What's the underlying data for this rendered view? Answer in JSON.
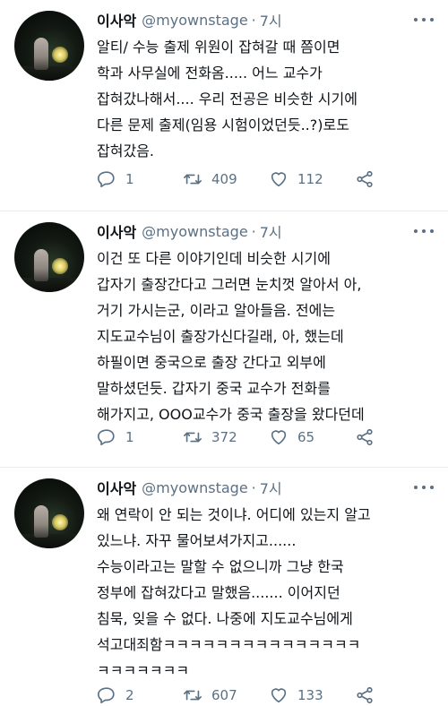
{
  "tweets": [
    {
      "name": "이사악",
      "handle": "@myownstage",
      "separator": "·",
      "time": "7시",
      "text": "알티/ 수능 출제 위원이 잡혀갈 때 쯤이면\n학과 사무실에 전화옴..... 어느 교수가\n잡혀갔나해서.... 우리 전공은 비슷한 시기에\n다른 문제 출제(임용 시험이었던듯..?)로도\n잡혀갔음.",
      "replies": "1",
      "retweets": "409",
      "likes": "112"
    },
    {
      "name": "이사악",
      "handle": "@myownstage",
      "separator": "·",
      "time": "7시",
      "text": "이건 또 다른 이야기인데 비슷한 시기에\n갑자기 출장간다고 그러면 눈치껏 알아서 아,\n거기 가시는군, 이라고 알아들음. 전에는\n지도교수님이 출장가신다길래, 아, 했는데\n하필이면 중국으로 출장 간다고 외부에\n말하셨던듯. 갑자기 중국 교수가 전화를\n해가지고, OOO교수가 중국 출장을 왔다던데",
      "replies": "1",
      "retweets": "372",
      "likes": "65"
    },
    {
      "name": "이사악",
      "handle": "@myownstage",
      "separator": "·",
      "time": "7시",
      "text": "왜 연락이 안 되는 것이냐. 어디에 있는지 알고\n있느냐. 자꾸 물어보셔가지고......\n수능이라고는 말할 수 없으니까 그냥 한국\n정부에 잡혀갔다고 말했음....... 이어지던\n침묵, 잊을 수 없다. 나중에 지도교수님에게\n석고대죄함ㅋㅋㅋㅋㅋㅋㅋㅋㅋㅋㅋㅋㅋㅋㅋ\nㅋㅋㅋㅋㅋㅋㅋ",
      "replies": "2",
      "retweets": "607",
      "likes": "133"
    }
  ],
  "icons": {
    "reply": "reply-icon",
    "retweet": "retweet-icon",
    "like": "heart-icon",
    "share": "share-icon",
    "more": "more-icon"
  },
  "colors": {
    "text": "#0f1419",
    "secondary": "#5b7083",
    "divider": "#e6ecf0"
  }
}
